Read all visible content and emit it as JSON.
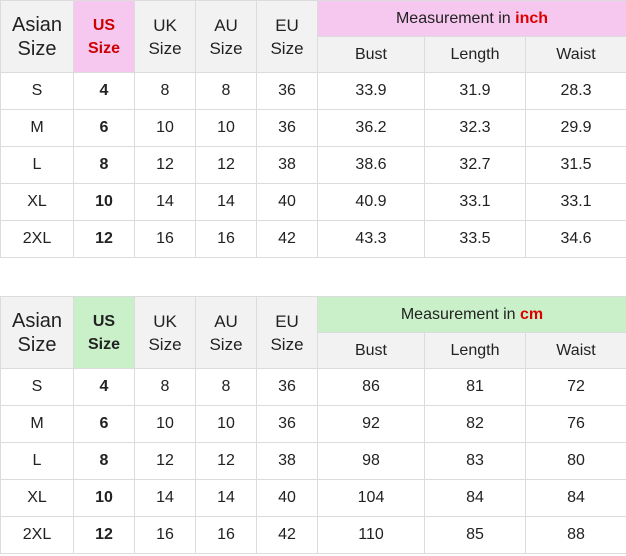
{
  "tables": [
    {
      "headers": {
        "asian": [
          "Asian",
          "Size"
        ],
        "us": [
          "US",
          "Size"
        ],
        "uk": [
          "UK",
          "Size"
        ],
        "au": [
          "AU",
          "Size"
        ],
        "eu": [
          "EU",
          "Size"
        ],
        "measurement_prefix": "Measurement in",
        "measurement_unit": "inch",
        "sub": [
          "Bust",
          "Length",
          "Waist"
        ]
      },
      "rows": [
        [
          "S",
          "4",
          "8",
          "8",
          "36",
          "33.9",
          "31.9",
          "28.3"
        ],
        [
          "M",
          "6",
          "10",
          "10",
          "36",
          "36.2",
          "32.3",
          "29.9"
        ],
        [
          "L",
          "8",
          "12",
          "12",
          "38",
          "38.6",
          "32.7",
          "31.5"
        ],
        [
          "XL",
          "10",
          "14",
          "14",
          "40",
          "40.9",
          "33.1",
          "33.1"
        ],
        [
          "2XL",
          "12",
          "16",
          "16",
          "42",
          "43.3",
          "33.5",
          "34.6"
        ]
      ]
    },
    {
      "headers": {
        "asian": [
          "Asian",
          "Size"
        ],
        "us": [
          "US",
          "Size"
        ],
        "uk": [
          "UK",
          "Size"
        ],
        "au": [
          "AU",
          "Size"
        ],
        "eu": [
          "EU",
          "Size"
        ],
        "measurement_prefix": "Measurement in",
        "measurement_unit": "cm",
        "sub": [
          "Bust",
          "Length",
          "Waist"
        ]
      },
      "rows": [
        [
          "S",
          "4",
          "8",
          "8",
          "36",
          "86",
          "81",
          "72"
        ],
        [
          "M",
          "6",
          "10",
          "10",
          "36",
          "92",
          "82",
          "76"
        ],
        [
          "L",
          "8",
          "12",
          "12",
          "38",
          "98",
          "83",
          "80"
        ],
        [
          "XL",
          "10",
          "14",
          "14",
          "40",
          "104",
          "84",
          "84"
        ],
        [
          "2XL",
          "12",
          "16",
          "16",
          "42",
          "110",
          "85",
          "88"
        ]
      ]
    }
  ],
  "colors": {
    "inch_header_bg": "#f7c8ef",
    "cm_header_bg": "#c9f0c9",
    "unit_text": "#dd0000",
    "header_gray": "#f2f2f2"
  }
}
